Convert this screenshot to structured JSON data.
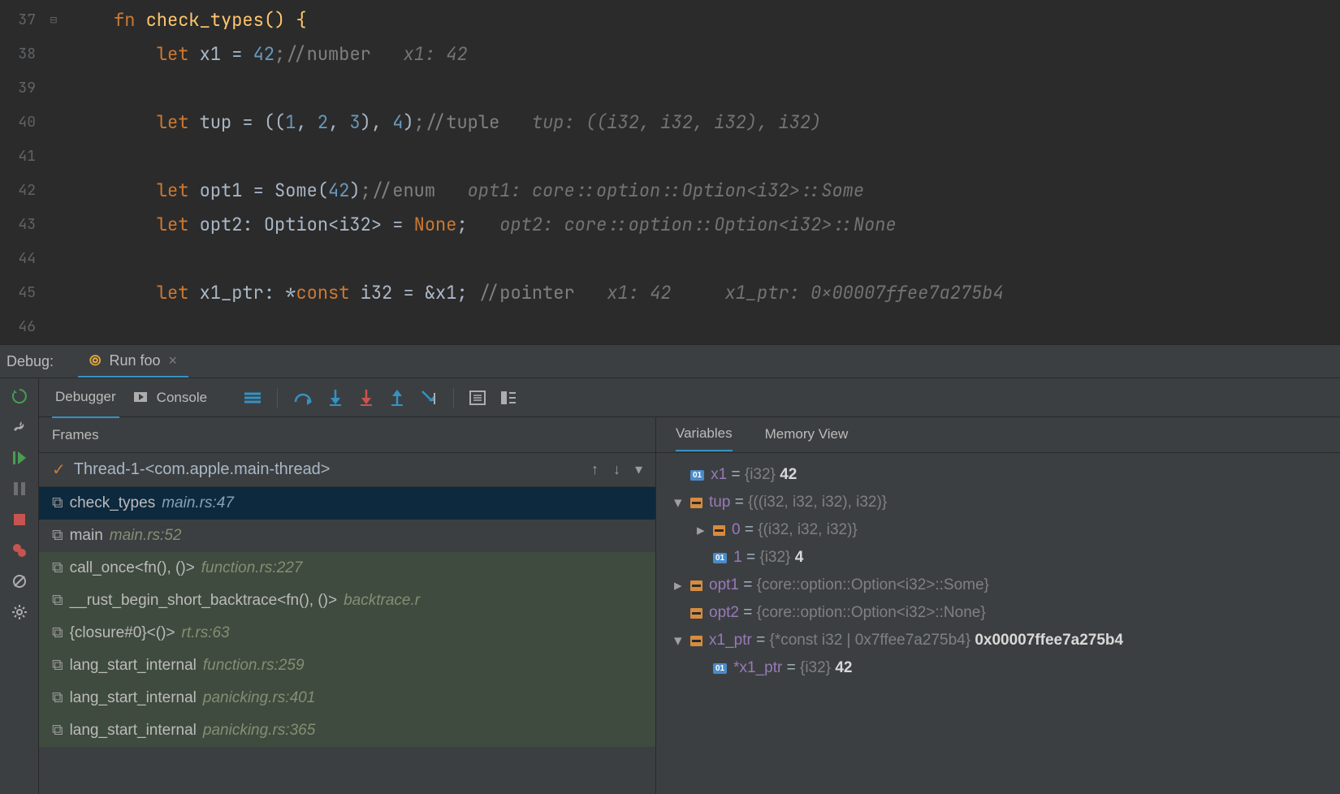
{
  "editor": {
    "lines": [
      {
        "num": "37"
      },
      {
        "num": "38",
        "hint": "x1: 42"
      },
      {
        "num": "39"
      },
      {
        "num": "40",
        "comment": ";//tuple",
        "hint": "tup: ((i32, i32, i32), i32)"
      },
      {
        "num": "41"
      },
      {
        "num": "42",
        "comment": ";//enum",
        "hint": "opt1: core::option::Option<i32>::Some"
      },
      {
        "num": "43",
        "hint": "opt2: core::option::Option<i32>::None"
      },
      {
        "num": "44"
      },
      {
        "num": "45",
        "hint": "x1: 42     x1_ptr: 0x00007ffee7a275b4"
      },
      {
        "num": "46"
      }
    ],
    "fn_sig": "check_types() {",
    "comment_number": ";//number",
    "comment_tuple": ";//tuple",
    "comment_enum": ";//enum",
    "comment_pointer": "//pointer",
    "opt2_decl_a": "opt2: Option<i32> = ",
    "opt2_decl_b": "None",
    "semi": ";",
    "ptr_a": "x1_ptr: *",
    "ptr_b": "const",
    "ptr_c": " i32 = &x1; "
  },
  "debugbar": {
    "label": "Debug:",
    "tab": "Run foo"
  },
  "toolwindow": {
    "debugger_tab": "Debugger",
    "console_tab": "Console",
    "frames_header": "Frames",
    "thread": "Thread-1-<com.apple.main-thread>",
    "variables_tab": "Variables",
    "memory_tab": "Memory View"
  },
  "frames": [
    {
      "name": "check_types",
      "loc": "main.rs:47",
      "sel": true
    },
    {
      "name": "main",
      "loc": "main.rs:52"
    },
    {
      "name": "call_once<fn(), ()>",
      "loc": "function.rs:227",
      "lib": true
    },
    {
      "name": "__rust_begin_short_backtrace<fn(), ()>",
      "loc": "backtrace.r",
      "lib": true
    },
    {
      "name": "{closure#0}<()>",
      "loc": "rt.rs:63",
      "lib": true
    },
    {
      "name": "lang_start_internal",
      "loc": "function.rs:259",
      "lib": true
    },
    {
      "name": "lang_start_internal",
      "loc": "panicking.rs:401",
      "lib": true
    },
    {
      "name": "lang_start_internal",
      "loc": "panicking.rs:365",
      "lib": true
    }
  ],
  "vars": {
    "x1": {
      "name": "x1",
      "type": "{i32}",
      "val": "42"
    },
    "tup": {
      "name": "tup",
      "type": "{((i32, i32, i32), i32)}"
    },
    "tup0": {
      "name": "0",
      "type": "{(i32, i32, i32)}"
    },
    "tup1": {
      "name": "1",
      "type": "{i32}",
      "val": "4"
    },
    "opt1": {
      "name": "opt1",
      "type": "{core::option::Option<i32>::Some}"
    },
    "opt2": {
      "name": "opt2",
      "type": "{core::option::Option<i32>::None}"
    },
    "x1ptr": {
      "name": "x1_ptr",
      "type": "{*const i32 | 0x7ffee7a275b4}",
      "val": "0x00007ffee7a275b4"
    },
    "derefptr": {
      "name": "*x1_ptr",
      "type": "{i32}",
      "val": "42"
    }
  }
}
